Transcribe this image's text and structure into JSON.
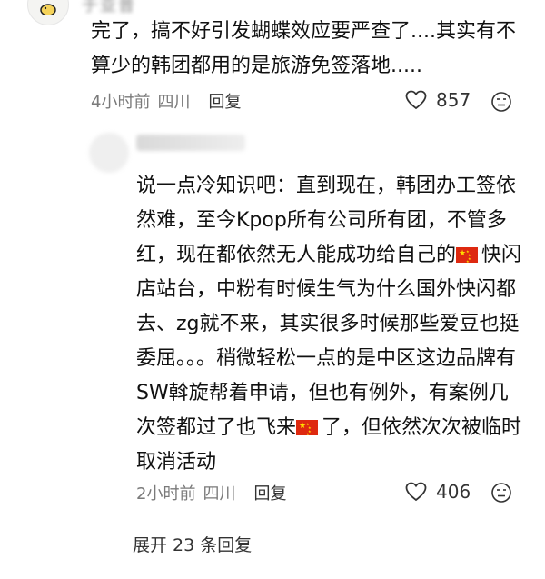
{
  "top_comment": {
    "username": "于亚普",
    "text": "完了，搞不好引发蝴蝶效应要严查了....其实有不算少的韩团都用的是旅游免签落地.....",
    "time": "4小时前",
    "location": "四川",
    "reply_label": "回复",
    "likes": "857"
  },
  "reply_comment": {
    "username": "红酱",
    "text_part1": "说一点冷知识吧：直到现在，韩团办工签依然难，至今Kpop所有公司所有团，不管多红，现在都依然无人能成功给自己的",
    "flag1": "china-flag-icon",
    "text_part2": "快闪店站台，中粉有时候生气为什么国外快闪都去、zg就不来，其实很多时候那些爱豆也挺委屈。。。稍微轻松一点的是中区这边品牌有SW斡旋帮着申请，但也有例外，有案例几次签都过了也飞来",
    "flag2": "china-flag-icon",
    "text_part3": "了，但依然次次被临时取消活动",
    "time": "2小时前",
    "location": "四川",
    "reply_label": "回复",
    "likes": "406"
  },
  "expand_label": "展开 23 条回复",
  "colors": {
    "text": "#111111",
    "meta": "#7a7a7a",
    "flag_red": "#de2910",
    "flag_star": "#ffde00"
  }
}
